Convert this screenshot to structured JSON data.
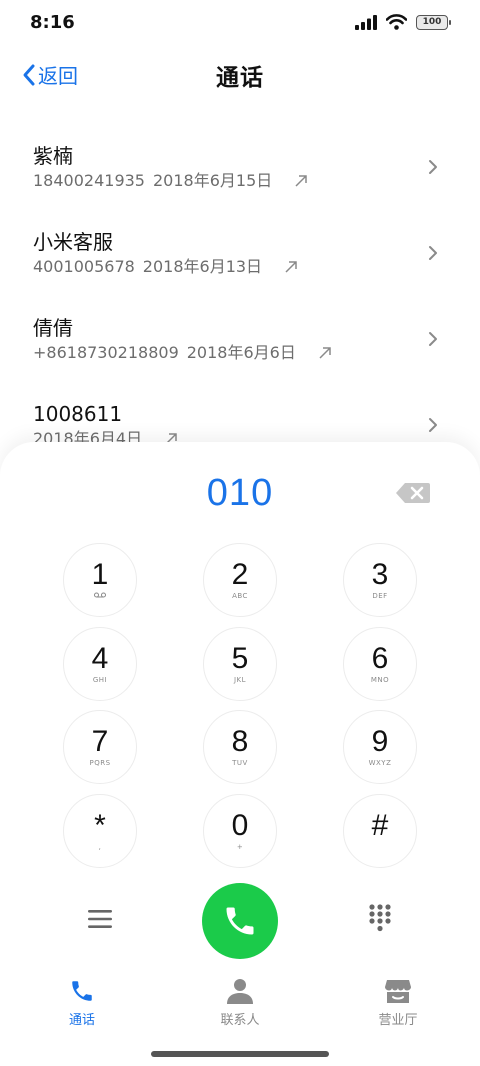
{
  "status_bar": {
    "time": "8:16",
    "battery": "100"
  },
  "header": {
    "back_label": "返回",
    "title": "通话"
  },
  "calls": [
    {
      "name": "紫楠",
      "number": "18400241935",
      "date": "2018年6月15日"
    },
    {
      "name": "小米客服",
      "number": "4001005678",
      "date": "2018年6月13日"
    },
    {
      "name": "倩倩",
      "number": "+8618730218809",
      "date": "2018年6月6日"
    },
    {
      "name": "1008611",
      "number": "",
      "date": "2018年6月4日"
    }
  ],
  "dialpad": {
    "number": "010",
    "keys": [
      {
        "digit": "1",
        "letters": "voicemail"
      },
      {
        "digit": "2",
        "letters": "ABC"
      },
      {
        "digit": "3",
        "letters": "DEF"
      },
      {
        "digit": "4",
        "letters": "GHI"
      },
      {
        "digit": "5",
        "letters": "JKL"
      },
      {
        "digit": "6",
        "letters": "MNO"
      },
      {
        "digit": "7",
        "letters": "PQRS"
      },
      {
        "digit": "8",
        "letters": "TUV"
      },
      {
        "digit": "9",
        "letters": "WXYZ"
      },
      {
        "digit": "*",
        "letters": ","
      },
      {
        "digit": "0",
        "letters": "+"
      },
      {
        "digit": "#",
        "letters": ""
      }
    ]
  },
  "tabs": [
    {
      "label": "通话",
      "icon": "phone-icon",
      "active": true
    },
    {
      "label": "联系人",
      "icon": "person-icon",
      "active": false
    },
    {
      "label": "营业厅",
      "icon": "store-icon",
      "active": false
    }
  ],
  "colors": {
    "accent": "#1a73e8",
    "call_green": "#1bcb4a",
    "subtext": "#6d6d6d"
  }
}
